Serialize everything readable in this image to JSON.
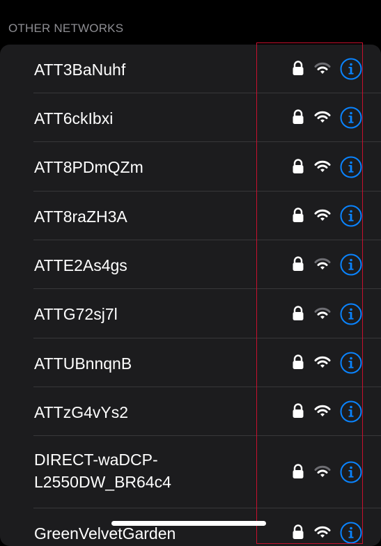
{
  "section": {
    "title": "OTHER NETWORKS"
  },
  "networks": [
    {
      "name": "ATT3BaNuhf",
      "signal": "strong-dim",
      "secured": true
    },
    {
      "name": "ATT6ckIbxi",
      "signal": "strong",
      "secured": true
    },
    {
      "name": "ATT8PDmQZm",
      "signal": "strong",
      "secured": true
    },
    {
      "name": "ATT8raZH3A",
      "signal": "strong",
      "secured": true
    },
    {
      "name": "ATTE2As4gs",
      "signal": "medium",
      "secured": true
    },
    {
      "name": "ATTG72sj7l",
      "signal": "medium",
      "secured": true
    },
    {
      "name": "ATTUBnnqnB",
      "signal": "strong",
      "secured": true
    },
    {
      "name": "ATTzG4vYs2",
      "signal": "strong",
      "secured": true
    },
    {
      "name": "DIRECT-waDCP-\nL2550DW_BR64c4",
      "signal": "medium",
      "secured": true
    },
    {
      "name": "GreenVelvetGarden",
      "signal": "strong",
      "secured": true
    }
  ],
  "icons": {
    "lock": "lock-icon",
    "wifi": "wifi-icon",
    "info": "info-icon"
  },
  "colors": {
    "accent": "#0a84ff",
    "background": "#000000",
    "card": "#1c1c1e",
    "highlight": "#c8102e"
  }
}
